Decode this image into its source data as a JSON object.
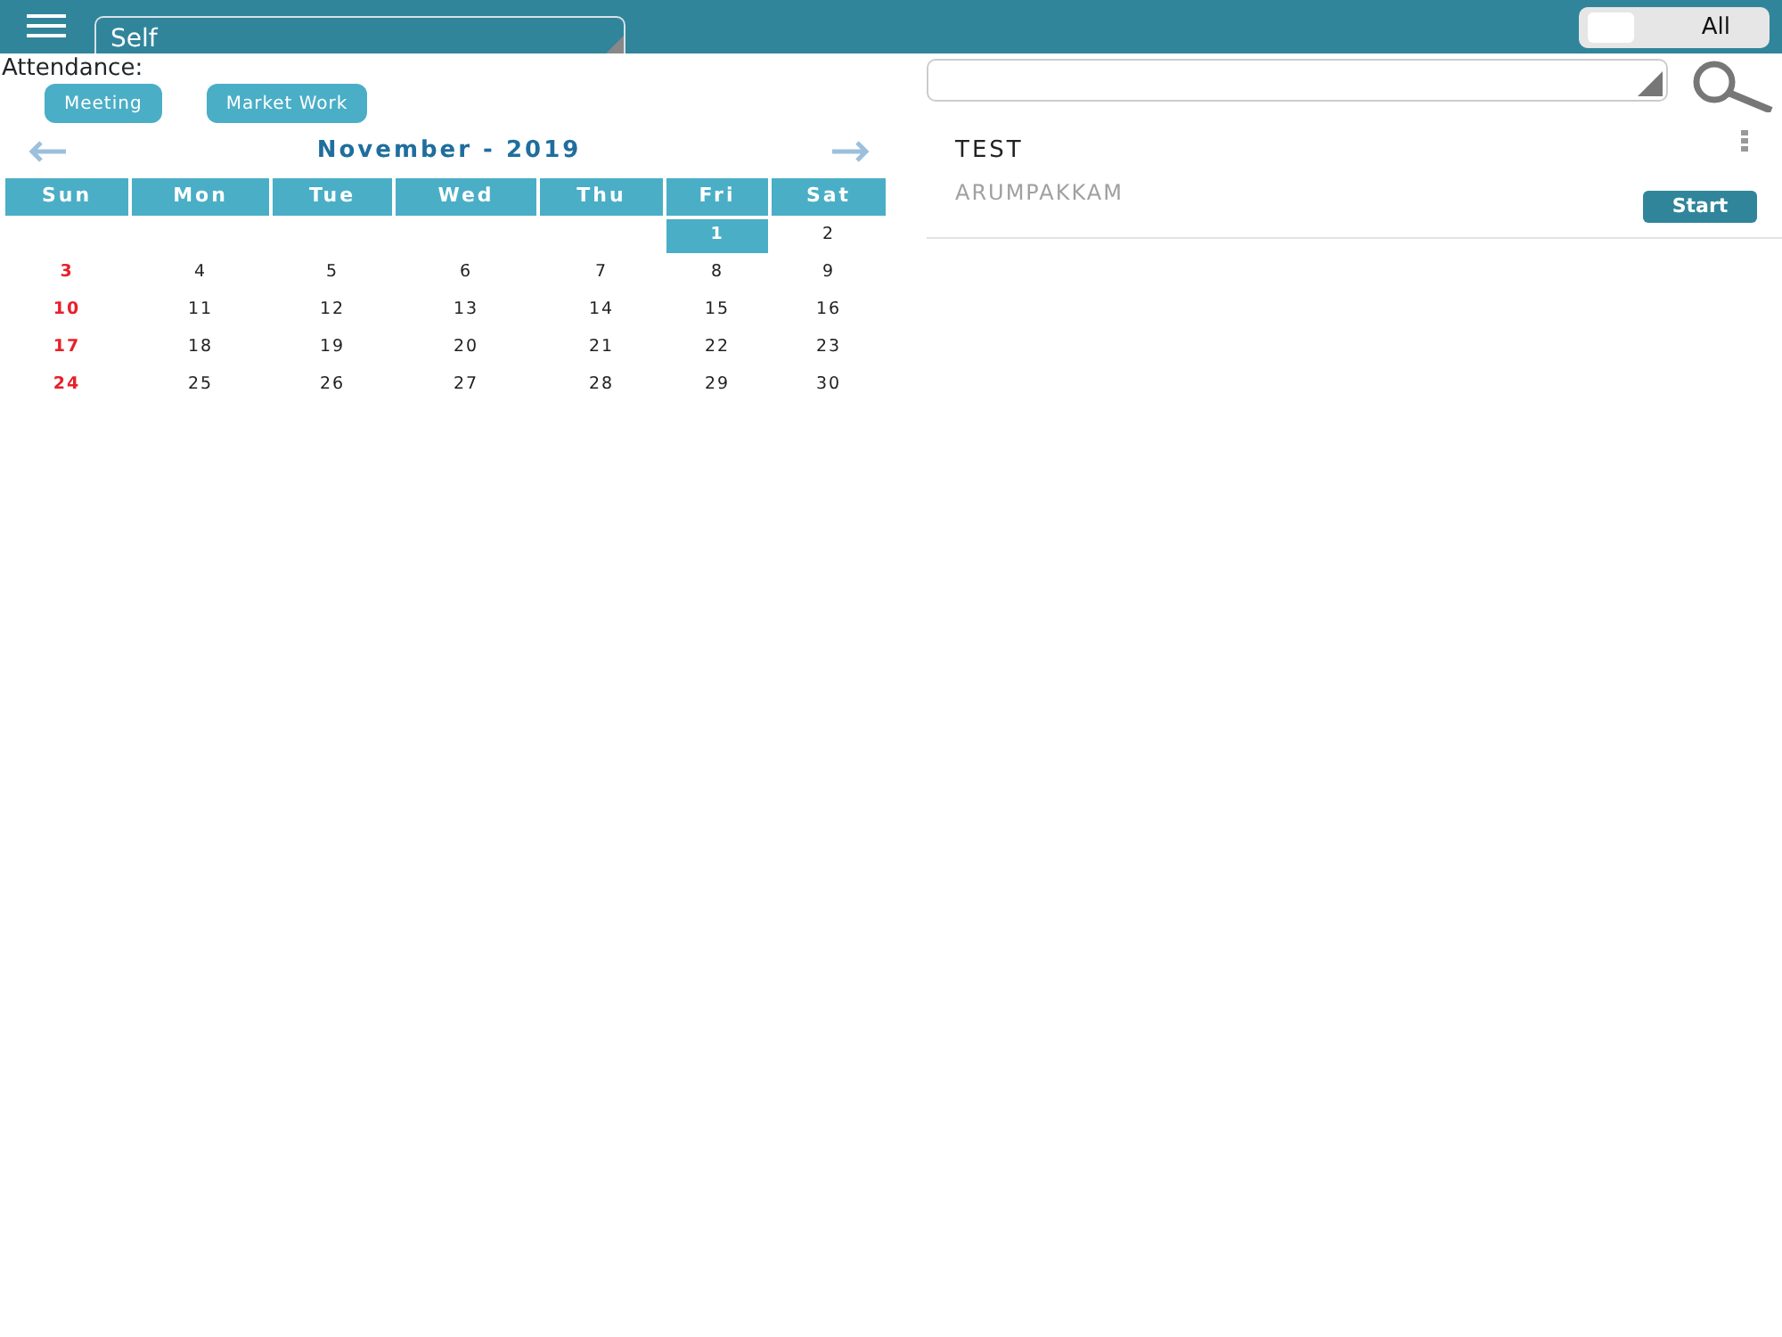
{
  "header": {
    "scope_select": {
      "value": "Self"
    },
    "toggle": {
      "label": "All",
      "on": false
    }
  },
  "attendance": {
    "label": "Attendance:",
    "buttons": [
      "Meeting",
      "Market Work"
    ]
  },
  "calendar": {
    "title": "November - 2019",
    "weekdays": [
      "Sun",
      "Mon",
      "Tue",
      "Wed",
      "Thu",
      "Fri",
      "Sat"
    ],
    "weeks": [
      [
        {
          "label": "1",
          "selected": true,
          "holiday": false
        },
        {
          "label": "2",
          "selected": false,
          "holiday": false
        }
      ],
      [
        {
          "label": "3",
          "selected": false,
          "holiday": true
        },
        {
          "label": "4",
          "selected": false,
          "holiday": false
        },
        {
          "label": "5",
          "selected": false,
          "holiday": false
        },
        {
          "label": "6",
          "selected": false,
          "holiday": false
        },
        {
          "label": "7",
          "selected": false,
          "holiday": false
        },
        {
          "label": "8",
          "selected": false,
          "holiday": false
        },
        {
          "label": "9",
          "selected": false,
          "holiday": false
        }
      ],
      [
        {
          "label": "10",
          "selected": false,
          "holiday": true
        },
        {
          "label": "11",
          "selected": false,
          "holiday": false
        },
        {
          "label": "12",
          "selected": false,
          "holiday": false
        },
        {
          "label": "13",
          "selected": false,
          "holiday": false
        },
        {
          "label": "14",
          "selected": false,
          "holiday": false
        },
        {
          "label": "15",
          "selected": false,
          "holiday": false
        },
        {
          "label": "16",
          "selected": false,
          "holiday": false
        }
      ],
      [
        {
          "label": "17",
          "selected": false,
          "holiday": true
        },
        {
          "label": "18",
          "selected": false,
          "holiday": false
        },
        {
          "label": "19",
          "selected": false,
          "holiday": false
        },
        {
          "label": "20",
          "selected": false,
          "holiday": false
        },
        {
          "label": "21",
          "selected": false,
          "holiday": false
        },
        {
          "label": "22",
          "selected": false,
          "holiday": false
        },
        {
          "label": "23",
          "selected": false,
          "holiday": false
        }
      ],
      [
        {
          "label": "24",
          "selected": false,
          "holiday": true
        },
        {
          "label": "25",
          "selected": false,
          "holiday": false
        },
        {
          "label": "26",
          "selected": false,
          "holiday": false
        },
        {
          "label": "27",
          "selected": false,
          "holiday": false
        },
        {
          "label": "28",
          "selected": false,
          "holiday": false
        },
        {
          "label": "29",
          "selected": false,
          "holiday": false
        },
        {
          "label": "30",
          "selected": false,
          "holiday": false
        }
      ]
    ]
  },
  "visits": [
    {
      "name": "TEST",
      "location": "ARUMPAKKAM",
      "action": "Start"
    }
  ]
}
